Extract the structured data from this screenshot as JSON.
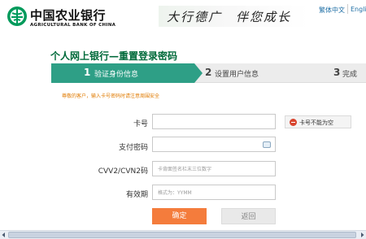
{
  "header": {
    "bank_name_cn": "中国农业银行",
    "bank_name_en": "AGRICULTURAL BANK OF CHINA",
    "slogan": "大行德广　伴您成长",
    "lang_traditional": "繁体中文",
    "lang_english": "Engli",
    "logo_icon": "abc-logo-icon"
  },
  "page": {
    "title": "个人网上银行—重置登录密码"
  },
  "steps": [
    {
      "num": "1",
      "label": "验证身份信息",
      "active": true
    },
    {
      "num": "2",
      "label": "设置用户信息",
      "active": false
    },
    {
      "num": "3",
      "label": "完成",
      "active": false
    }
  ],
  "notice": "尊敬的客户，输入卡号密码时请注意周围安全",
  "form": {
    "card_number": {
      "label": "卡号",
      "value": "",
      "placeholder": ""
    },
    "card_error": "卡号不能为空",
    "password": {
      "label": "支付密码",
      "value": "",
      "placeholder": "",
      "icon": "keyboard-icon"
    },
    "cvv": {
      "label": "CVV2/CVN2码",
      "value": "",
      "placeholder": "卡背面签名栏末三位数字"
    },
    "expiry": {
      "label": "有效期",
      "value": "",
      "placeholder": "格式为：YYMM"
    }
  },
  "buttons": {
    "confirm": "确定",
    "back": "返回"
  },
  "colors": {
    "brand_green": "#006a3a",
    "step_active": "#2e9f86",
    "notice_orange": "#e07a00",
    "confirm_button": "#f47c3c",
    "error_red": "#d8442e",
    "link_blue": "#1f6fa5"
  }
}
